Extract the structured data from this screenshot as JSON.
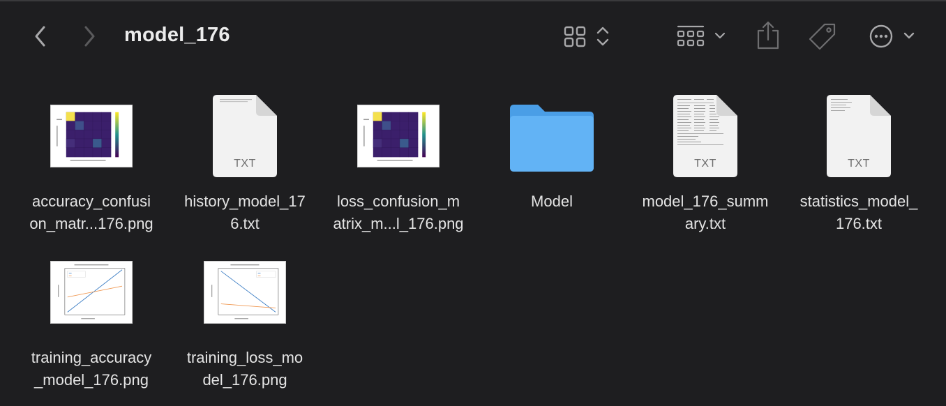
{
  "window": {
    "title": "model_176"
  },
  "toolbar": {
    "back_icon": "chevron-left-icon",
    "forward_icon": "chevron-right-icon",
    "view_icon": "grid-view-icon",
    "group_icon": "group-icon",
    "share_icon": "share-icon",
    "tag_icon": "tag-icon",
    "more_icon": "ellipsis-circle-icon"
  },
  "files": [
    {
      "name_line1": "accuracy_confusi",
      "name_line2": "on_matr...176.png",
      "kind": "image-confusion"
    },
    {
      "name_line1": "history_model_17",
      "name_line2": "6.txt",
      "kind": "txt",
      "badge": "TXT"
    },
    {
      "name_line1": "loss_confusion_m",
      "name_line2": "atrix_m...l_176.png",
      "kind": "image-confusion"
    },
    {
      "name_line1": "Model",
      "name_line2": "",
      "kind": "folder"
    },
    {
      "name_line1": "model_176_summ",
      "name_line2": "ary.txt",
      "kind": "txt",
      "badge": "TXT"
    },
    {
      "name_line1": "statistics_model_",
      "name_line2": "176.txt",
      "kind": "txt",
      "badge": "TXT"
    },
    {
      "name_line1": "training_accuracy",
      "name_line2": "_model_176.png",
      "kind": "image-line-accuracy"
    },
    {
      "name_line1": "training_loss_mo",
      "name_line2": "del_176.png",
      "kind": "image-line-loss"
    }
  ],
  "colors": {
    "background": "#1e1e20",
    "folder": "#5aaef0",
    "icon": "#9a9a9c"
  }
}
